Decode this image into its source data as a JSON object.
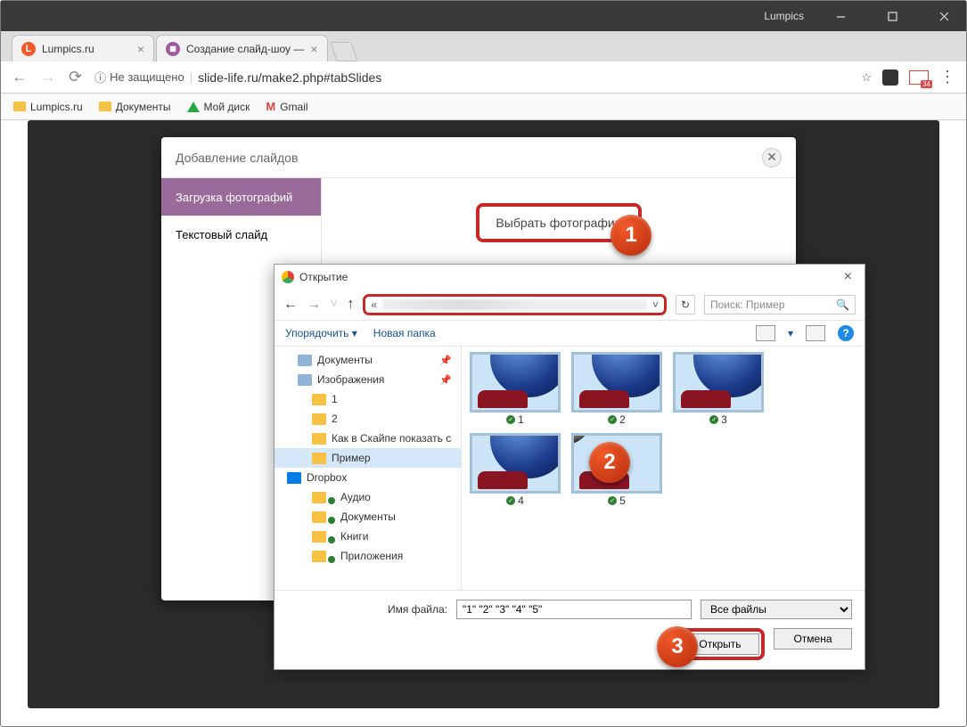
{
  "window": {
    "app_name": "Lumpics"
  },
  "browser": {
    "tabs": [
      {
        "title": "Lumpics.ru",
        "favicon_color": "#f25a2a"
      },
      {
        "title": "Создание слайд-шоу —",
        "favicon_color": "#a05aa0"
      }
    ],
    "address": {
      "insecure_label": "Не защищено",
      "url_display": "slide-life.ru/make2.php#tabSlides"
    },
    "gmail_badge": "34",
    "bookmarks": [
      {
        "label": "Lumpics.ru",
        "icon": "folder"
      },
      {
        "label": "Документы",
        "icon": "folder"
      },
      {
        "label": "Мой диск",
        "icon": "drive"
      },
      {
        "label": "Gmail",
        "icon": "gmail"
      }
    ]
  },
  "modal": {
    "title": "Добавление слайдов",
    "tabs": {
      "upload": "Загрузка фотографий",
      "text": "Текстовый слайд"
    },
    "choose_button": "Выбрать фотографии"
  },
  "filedlg": {
    "title": "Открытие",
    "search_placeholder": "Поиск: Пример",
    "toolbar": {
      "organize": "Упорядочить",
      "new_folder": "Новая папка"
    },
    "tree": {
      "documents": "Документы",
      "images": "Изображения",
      "f1": "1",
      "f2": "2",
      "skype": "Как в Скайпе показать с",
      "example": "Пример",
      "dropbox": "Dropbox",
      "audio": "Аудио",
      "docs": "Документы",
      "books": "Книги",
      "apps": "Приложения"
    },
    "files": [
      "1",
      "2",
      "3",
      "4",
      "5"
    ],
    "filename_label": "Имя файла:",
    "filename_value": "\"1\" \"2\" \"3\" \"4\" \"5\"",
    "filter": "Все файлы",
    "open_btn": "Открыть",
    "cancel_btn": "Отмена"
  },
  "callouts": {
    "c1": "1",
    "c2": "2",
    "c3": "3"
  }
}
